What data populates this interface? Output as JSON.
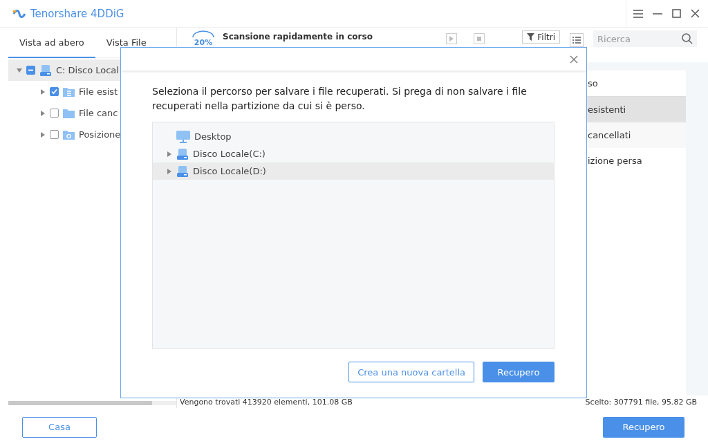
{
  "window": {
    "title": "Tenorshare 4DDiG"
  },
  "view_tabs": [
    {
      "label": "Vista ad abero",
      "selected": true
    },
    {
      "label": "Vista File",
      "selected": false
    }
  ],
  "tree": [
    {
      "label": "C: Disco Local",
      "kind": "drive",
      "checked": false,
      "partial": true,
      "selected": true,
      "expanded": true,
      "children": [
        {
          "label": "File esist",
          "kind": "existing",
          "checked": true,
          "partial": false,
          "selected": false,
          "expanded": false
        },
        {
          "label": "File canc",
          "kind": "deleted",
          "checked": false,
          "partial": false,
          "selected": false,
          "expanded": false
        },
        {
          "label": "Posizione",
          "kind": "lost",
          "checked": false,
          "partial": false,
          "selected": false,
          "expanded": false
        }
      ]
    }
  ],
  "scan": {
    "percent": "20%",
    "title": "Scansione rapidamente in corso"
  },
  "toolbar": {
    "filter_label": "Filtri",
    "search": {
      "placeholder": "Ricerca"
    }
  },
  "category_list": {
    "header": "so",
    "items": [
      {
        "label": "esistenti",
        "selected": true
      },
      {
        "label": "cancellati",
        "selected": false
      },
      {
        "label": "izione persa",
        "selected": false
      }
    ]
  },
  "status_bar": {
    "found": "Vengono trovati 413920 elementi, 101.08 GB",
    "selected": "Scelto: 307791 file, 95.82 GB"
  },
  "footer": {
    "home_button": "Casa",
    "recover_button": "Recupero"
  },
  "dialog": {
    "message": "Seleziona il percorso per salvare i file recuperati. Si prega di non salvare i file recuperati nella partizione da cui si è perso.",
    "locations": [
      {
        "label": "Desktop",
        "kind": "desktop",
        "expandable": false,
        "selected": false
      },
      {
        "label": "Disco Locale(C:)",
        "kind": "drive",
        "expandable": true,
        "selected": false
      },
      {
        "label": "Disco Locale(D:)",
        "kind": "drive",
        "expandable": true,
        "selected": true
      }
    ],
    "new_folder_button": "Crea una nuova cartella",
    "recover_button": "Recupero"
  }
}
